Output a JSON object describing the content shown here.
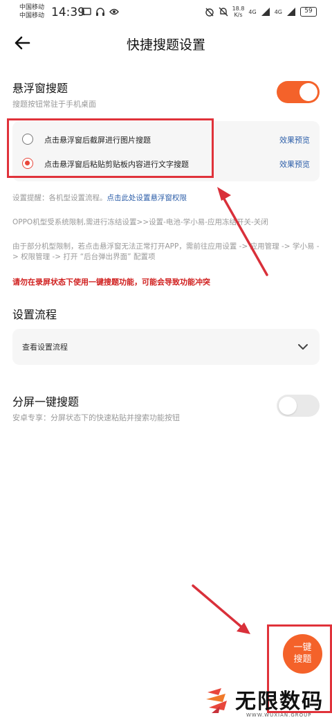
{
  "status_bar": {
    "carrier_1": "中国移动",
    "carrier_2": "中国移动",
    "time": "14:39",
    "net_speed_value": "18.8",
    "net_speed_unit": "K/s",
    "signal_1": "4G",
    "signal_2": "4G",
    "battery": "59"
  },
  "header": {
    "title": "快捷搜题设置"
  },
  "floating_search": {
    "title": "悬浮窗搜题",
    "subtitle": "搜题按钮常驻于手机桌面",
    "enabled": true,
    "options": [
      {
        "label": "点击悬浮窗后截屏进行图片搜题",
        "preview": "效果预览",
        "selected": false
      },
      {
        "label": "点击悬浮窗后粘贴剪贴板内容进行文字搜题",
        "preview": "效果预览",
        "selected": true
      }
    ]
  },
  "tips": {
    "reminder_prefix": "设置提醒：各机型设置流程。",
    "reminder_link": "点击此处设置悬浮窗权限",
    "oppo": "OPPO机型受系统限制,需进行冻结设置>>设置-电池-学小易-应用冻结开关-关闭",
    "other": "由于部分机型限制，若点击悬浮窗无法正常打开APP，需前往应用设置 -> 应用管理 -> 学小易 -> 权限管理 -> 打开 “后台弹出界面” 配置项",
    "warning": "请勿在录屏状态下使用一键搜题功能，可能会导致功能冲突"
  },
  "setup_flow": {
    "title": "设置流程",
    "view_label": "查看设置流程"
  },
  "split_screen": {
    "title": "分屏一键搜题",
    "subtitle": "安卓专享：分屏状态下的快速粘贴并搜索功能按钮",
    "enabled": false
  },
  "fab": {
    "line1": "一键",
    "line2": "搜题"
  },
  "watermark": {
    "brand": "无限数码",
    "sub": "WWW.WUXIAN.GROUP"
  },
  "colors": {
    "accent": "#f4622a",
    "link": "#2b5da8",
    "warning": "#d0201f",
    "annotation": "#e0323a"
  }
}
